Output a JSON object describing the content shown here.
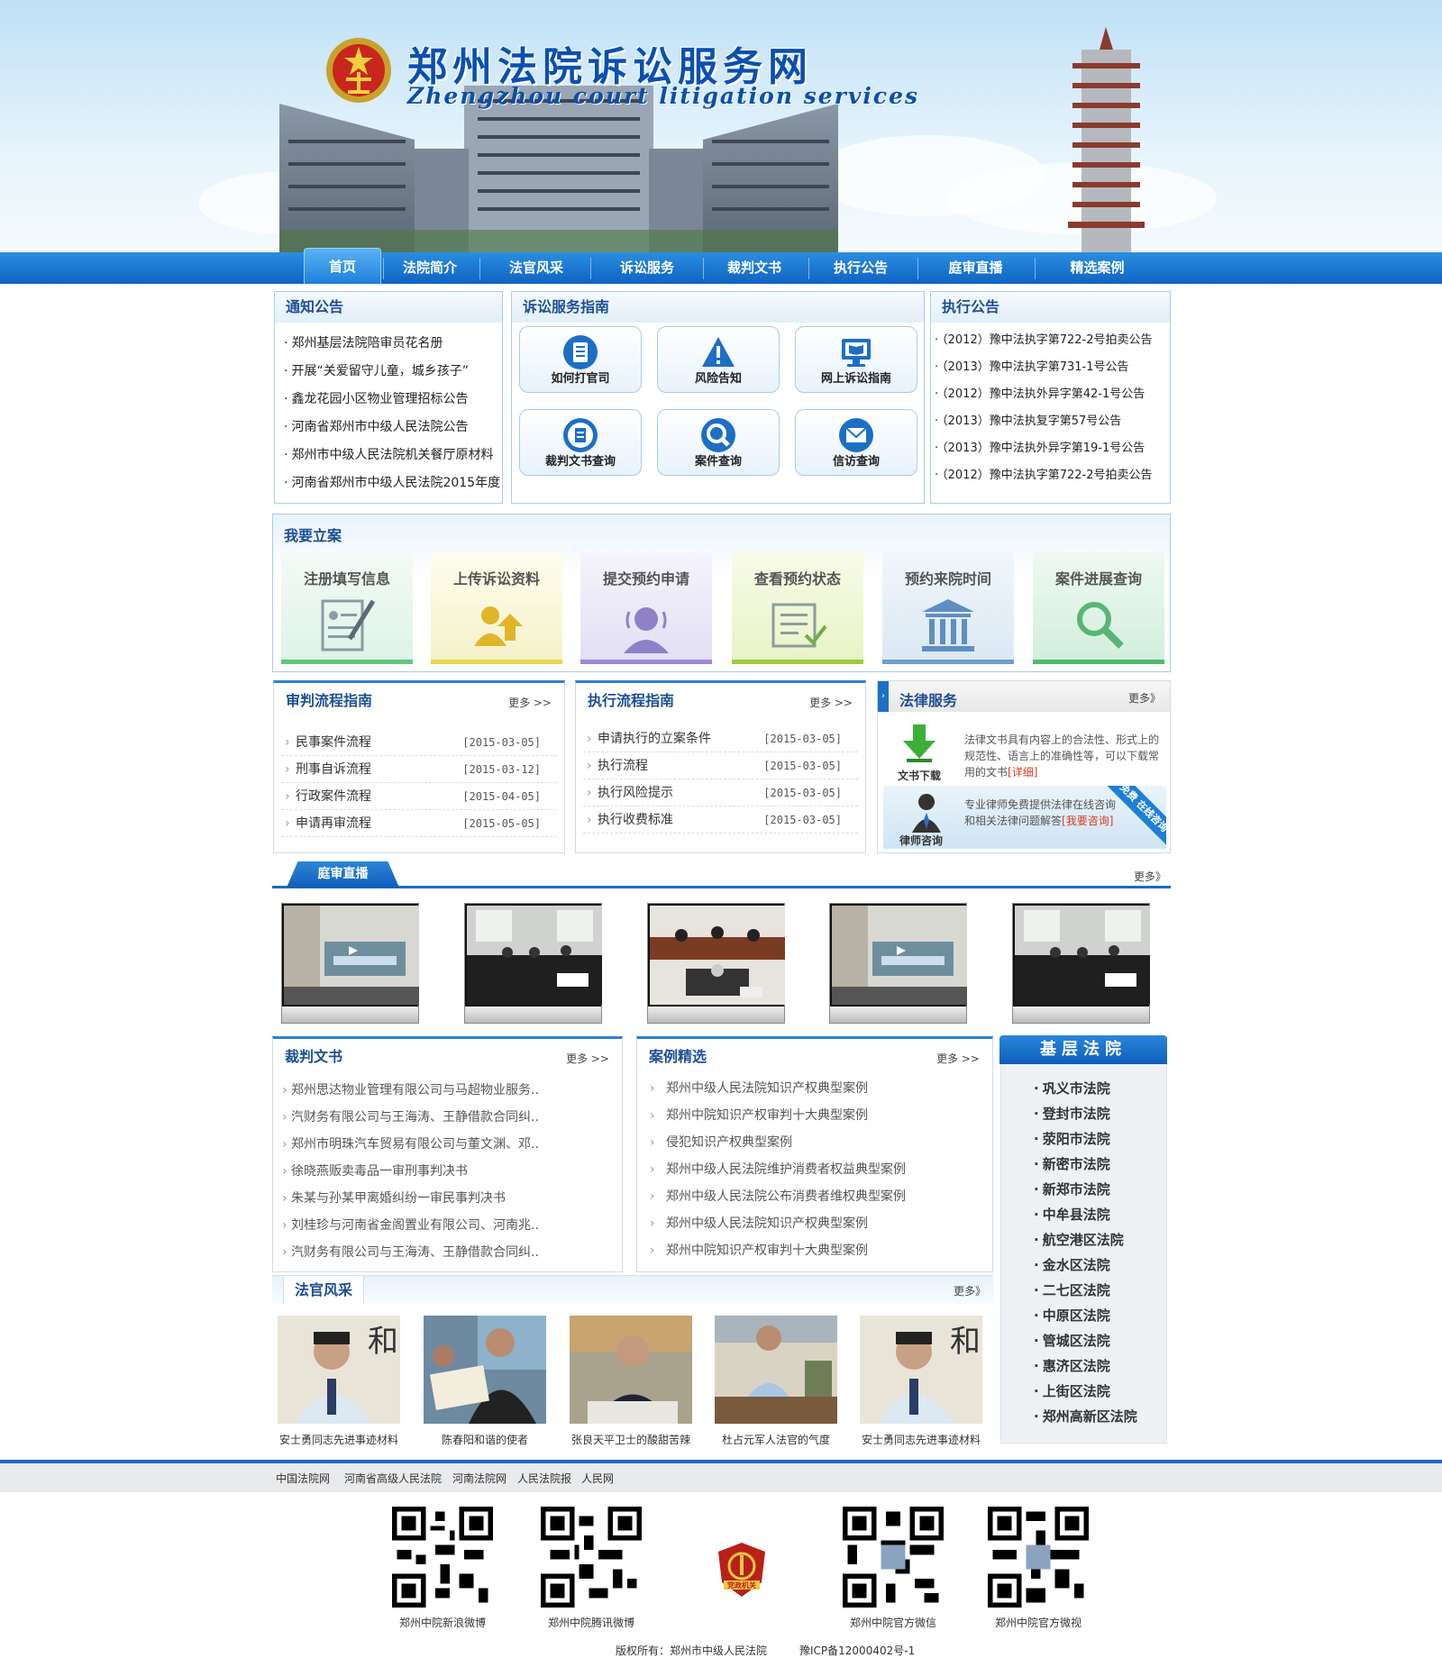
{
  "header": {
    "title": "郑州法院诉讼服务网",
    "subtitle": "Zhengzhou court litigation services"
  },
  "nav": [
    "首页",
    "法院简介",
    "法官风采",
    "诉讼服务",
    "裁判文书",
    "执行公告",
    "庭审直播",
    "精选案例"
  ],
  "notice": {
    "title": "通知公告",
    "items": [
      "郑州基层法院陪审员花名册",
      "开展“关爱留守儿童，城乡孩子”",
      "鑫龙花园小区物业管理招标公告",
      "河南省郑州市中级人民法院公告",
      "郑州市中级人民法院机关餐厅原材料",
      "河南省郑州市中级人民法院2015年度"
    ]
  },
  "guide": {
    "title": "诉讼服务指南",
    "buttons": [
      "如何打官司",
      "风险告知",
      "网上诉讼指南",
      "裁判文书查询",
      "案件查询",
      "信访查询"
    ]
  },
  "exec_notice": {
    "title": "执行公告",
    "items": [
      "（2012）豫中法执字第722-2号拍卖公告",
      "（2013）豫中法执字第731-1号公告",
      "（2012）豫中法执外异字第42-1号公告",
      "（2013）豫中法执复字第57号公告",
      "（2013）豫中法执外异字第19-1号公告",
      "（2012）豫中法执字第722-2号拍卖公告"
    ]
  },
  "filing": {
    "title": "我要立案",
    "steps": [
      "注册填写信息",
      "上传诉讼资料",
      "提交预约申请",
      "查看预约状态",
      "预约来院时间",
      "案件进展查询"
    ]
  },
  "trial_flow": {
    "title": "审判流程指南",
    "more": "更多 >>",
    "items": [
      {
        "t": "民事案件流程",
        "d": "[2015-03-05]"
      },
      {
        "t": "刑事自诉流程",
        "d": "[2015-03-12]"
      },
      {
        "t": "行政案件流程",
        "d": "[2015-04-05]"
      },
      {
        "t": "申请再审流程",
        "d": "[2015-05-05]"
      }
    ]
  },
  "exec_flow": {
    "title": "执行流程指南",
    "more": "更多 >>",
    "items": [
      {
        "t": "申请执行的立案条件",
        "d": "[2015-03-05]"
      },
      {
        "t": "执行流程",
        "d": "[2015-03-05]"
      },
      {
        "t": "执行风险提示",
        "d": "[2015-03-05]"
      },
      {
        "t": "执行收费标准",
        "d": "[2015-03-05]"
      }
    ]
  },
  "legal": {
    "title": "法律服务",
    "more": "更多》",
    "download_label": "文书下载",
    "download_text": "法律文书具有内容上的合法性、形式上的规范性、语言上的准确性等，可以下载常用的文书",
    "download_link": "[详细]",
    "lawyer_label": "律师咨询",
    "lawyer_text": "专业律师免费提供法律在线咨询和相关法律问题解答",
    "lawyer_link": "[我要咨询]",
    "ribbon": "免费 在线咨询"
  },
  "live": {
    "title": "庭审直播",
    "more": "更多》"
  },
  "judgments": {
    "title": "裁判文书",
    "more": "更多 >>",
    "items": [
      "郑州思达物业管理有限公司与马超物业服务..",
      "汽财务有限公司与王海涛、王静借款合同纠..",
      "郑州市明珠汽车贸易有限公司与董文渊、邓..",
      "徐晓燕贩卖毒品一审刑事判决书",
      "朱某与孙某甲离婚纠纷一审民事判决书",
      "刘桂珍与河南省金阁置业有限公司、河南兆..",
      "汽财务有限公司与王海涛、王静借款合同纠.."
    ]
  },
  "cases": {
    "title": "案例精选",
    "more": "更多 >>",
    "items": [
      "郑州中级人民法院知识产权典型案例",
      "郑州中院知识产权审判十大典型案例",
      "侵犯知识产权典型案例",
      "郑州中级人民法院维护消费者权益典型案例",
      "郑州中级人民法院公布消费者维权典型案例",
      "郑州中级人民法院知识产权典型案例",
      "郑州中院知识产权审判十大典型案例"
    ]
  },
  "courts": {
    "title": "基层法院",
    "items": [
      "巩义市法院",
      "登封市法院",
      "荥阳市法院",
      "新密市法院",
      "新郑市法院",
      "中牟县法院",
      "航空港区法院",
      "金水区法院",
      "二七区法院",
      "中原区法院",
      "管城区法院",
      "惠济区法院",
      "上街区法院",
      "郑州高新区法院"
    ]
  },
  "judges": {
    "title": "法官风采",
    "more": "更多》",
    "items": [
      "安士勇同志先进事迹材料",
      "陈春阳和谐的使者",
      "张良天平卫士的酸甜苦辣",
      "杜占元军人法官的气度",
      "安士勇同志先进事迹材料"
    ]
  },
  "footer": {
    "links": [
      "中国法院网",
      "河南省高级人民法院",
      "河南法院网",
      "人民法院报",
      "人民网"
    ],
    "qr_labels": [
      "郑州中院新浪微博",
      "郑州中院腾讯微博",
      "郑州中院官方微信",
      "郑州中院官方微视"
    ],
    "badge": "党政机关",
    "copyright": "版权所有：郑州市中级人民法院",
    "icp": "豫ICP备12000402号-1"
  },
  "colors": {
    "brand_blue": "#1a6bc6",
    "heading_blue": "#1c4f94",
    "card_green": "#5fc87e"
  }
}
